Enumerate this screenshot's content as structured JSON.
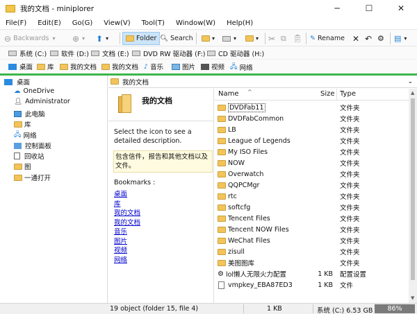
{
  "window": {
    "title": "我的文档 - miniplorer",
    "minimize": "─",
    "maximize": "☐",
    "close": "✕"
  },
  "menu": [
    "File(F)",
    "Edit(E)",
    "Go(G)",
    "View(V)",
    "Tool(T)",
    "Window(W)",
    "Help(H)"
  ],
  "toolbar": {
    "back": "Backwards",
    "folder": "Folder",
    "search": "Search",
    "rename": "Rename"
  },
  "drives": [
    "系统 (C:)",
    "软件 (D:)",
    "文档 (E:)",
    "DVD RW 驱动器 (F:)",
    "CD 驱动器 (H:)"
  ],
  "bookmarks_bar": [
    "桌面",
    "库",
    "我的文档",
    "我的文档",
    "音乐",
    "图片",
    "视频",
    "网络"
  ],
  "tree": [
    "桌面",
    "OneDrive",
    "Administrator",
    "此电脑",
    "库",
    "网络",
    "控制面板",
    "回收站",
    "图",
    "一通打开"
  ],
  "path": "我的文档",
  "info": {
    "folder_name": "我的文档",
    "hint": "Select the icon to see a detailed description.",
    "tip": "包含信件，报告和其他文档以及文件。",
    "bookmarks_label": "Bookmarks :",
    "links": [
      "桌面",
      "库",
      "我的文档",
      "我的文档",
      "音乐",
      "图片",
      "视频",
      "网络"
    ]
  },
  "columns": {
    "name": "Name",
    "size": "Size",
    "type": "Type"
  },
  "files": [
    {
      "name": "DVDFab11",
      "size": "",
      "type": "文件夹",
      "kind": "folder"
    },
    {
      "name": "DVDFabCommon",
      "size": "",
      "type": "文件夹",
      "kind": "folder"
    },
    {
      "name": "LB",
      "size": "",
      "type": "文件夹",
      "kind": "folder"
    },
    {
      "name": "League of Legends",
      "size": "",
      "type": "文件夹",
      "kind": "folder"
    },
    {
      "name": "My ISO Files",
      "size": "",
      "type": "文件夹",
      "kind": "folder"
    },
    {
      "name": "NOW",
      "size": "",
      "type": "文件夹",
      "kind": "folder"
    },
    {
      "name": "Overwatch",
      "size": "",
      "type": "文件夹",
      "kind": "folder"
    },
    {
      "name": "QQPCMgr",
      "size": "",
      "type": "文件夹",
      "kind": "folder"
    },
    {
      "name": "rtc",
      "size": "",
      "type": "文件夹",
      "kind": "folder"
    },
    {
      "name": "softcfg",
      "size": "",
      "type": "文件夹",
      "kind": "folder"
    },
    {
      "name": "Tencent Files",
      "size": "",
      "type": "文件夹",
      "kind": "folder"
    },
    {
      "name": "Tencent NOW Files",
      "size": "",
      "type": "文件夹",
      "kind": "folder"
    },
    {
      "name": "WeChat Files",
      "size": "",
      "type": "文件夹",
      "kind": "folder"
    },
    {
      "name": "zisull",
      "size": "",
      "type": "文件夹",
      "kind": "folder"
    },
    {
      "name": "美图图库",
      "size": "",
      "type": "文件夹",
      "kind": "folder"
    },
    {
      "name": "lol懒人无限火力配置",
      "size": "1 KB",
      "type": "配置设置",
      "kind": "config"
    },
    {
      "name": "vmpkey_EBA87ED3",
      "size": "1 KB",
      "type": "文件",
      "kind": "file"
    }
  ],
  "status": {
    "count": "19 object (folder 15, file 4)",
    "size": "1 KB",
    "drive": "系统 (C:) 6.53 GB",
    "percent": "86%"
  },
  "colors": {
    "accent_green": "#3cb54a",
    "selection": "#cce4f7",
    "folder": "#f2c45a",
    "link": "#0000cc"
  }
}
